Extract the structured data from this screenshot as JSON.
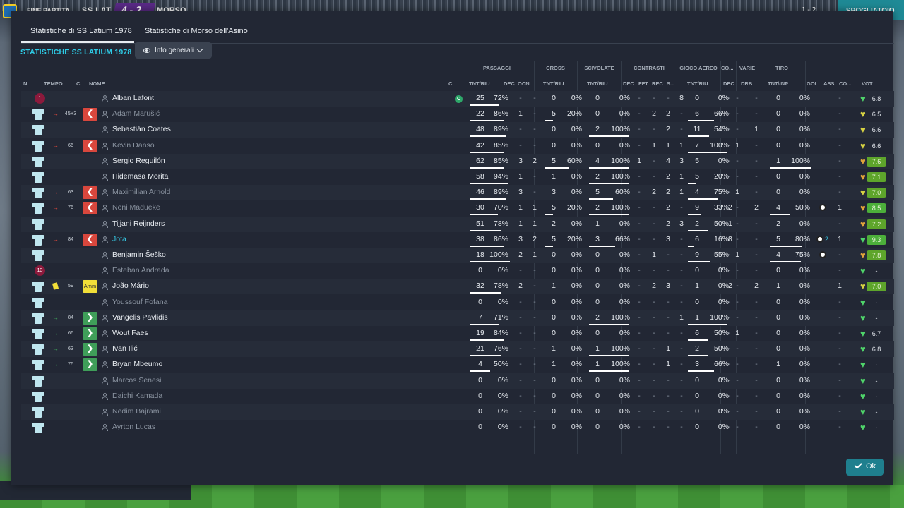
{
  "topbar": {
    "status": "FINE PARTITA",
    "home": "SS LAT",
    "score": "4 - 2",
    "away": "MORSO",
    "time": "1 - 2",
    "continue": "SPOGLIATOIO"
  },
  "tabs": [
    "Statistiche di SS Latium 1978",
    "Statistiche di Morso dell'Asino"
  ],
  "section_title": "STATISTICHE SS LATIUM 1978",
  "view_dropdown": {
    "selected": "Info generali"
  },
  "ok_label": "Ok",
  "colors": {
    "accent": "#2ecbe6",
    "panel": "#222734",
    "sub_out": "#d8473d",
    "sub_in": "#3f9e59",
    "ok": "#1f7f8e"
  },
  "groups": [
    "PASSAGGI",
    "CROSS",
    "SCIVOLATE",
    "CONTRASTI",
    "GIOCO AEREO",
    "VARIE",
    "TIRO"
  ],
  "headers": {
    "n": "N.",
    "tempo": "TEMPO",
    "c": "C",
    "nome": "NOME",
    "c2": "C",
    "pass_tnt": "TNT/RIU",
    "dec": "DEC",
    "ocn": "OCN",
    "cross_tnt": "TNT/RIU",
    "sciv_tnt": "TNT/RIU",
    "con_dec": "DEC",
    "fft": "FFT",
    "rec": "REC",
    "s": "S...",
    "aer_tnt": "TNT/RIU",
    "co": "CO...",
    "aer_dec": "DEC",
    "drb": "DRB",
    "tiro_tnt": "TNT\\INP",
    "gol": "GOL",
    "ass": "ASS",
    "co2": "CO...",
    "vot": "VOT"
  },
  "players": [
    {
      "num": "1",
      "gk": true,
      "name": "Alban Lafont",
      "tempo": "",
      "sub": "",
      "captain": true,
      "dim": false,
      "p": [
        "25",
        "72%",
        "-",
        "-"
      ],
      "cr": [
        "0",
        "0%"
      ],
      "sc": [
        "0",
        "0%"
      ],
      "con": [
        "-",
        "-",
        "-",
        "8"
      ],
      "aer": [
        "0",
        "0%",
        "-",
        "-"
      ],
      "var": "-",
      "ti": [
        "0",
        "0%"
      ],
      "gol": "",
      "ass": "-",
      "heart": "green",
      "vot": "6.8",
      "vcls": "",
      "pbar": 72,
      "crbar": 0,
      "scbar": 0,
      "aerbar": 0,
      "tibar": 0
    },
    {
      "num": "",
      "name": "Adam Marušić",
      "tempo": "45+3",
      "sub": "out",
      "dim": true,
      "p": [
        "22",
        "86%",
        "1",
        "-"
      ],
      "cr": [
        "5",
        "20%"
      ],
      "sc": [
        "0",
        "0%"
      ],
      "con": [
        "-",
        "2",
        "2",
        "-"
      ],
      "aer": [
        "6",
        "66%",
        "-",
        "-"
      ],
      "var": "-",
      "ti": [
        "0",
        "0%"
      ],
      "gol": "",
      "ass": "-",
      "heart": "yellow",
      "vot": "6.5",
      "vcls": "",
      "pbar": 86,
      "crbar": 20,
      "scbar": 0,
      "aerbar": 66,
      "tibar": 0
    },
    {
      "num": "",
      "name": "Sebastián Coates",
      "tempo": "",
      "sub": "",
      "dim": false,
      "p": [
        "48",
        "89%",
        "-",
        "-"
      ],
      "cr": [
        "0",
        "0%"
      ],
      "sc": [
        "2",
        "100%"
      ],
      "con": [
        "-",
        "-",
        "2",
        "-"
      ],
      "aer": [
        "11",
        "54%",
        "-",
        "1"
      ],
      "var": "-",
      "ti": [
        "0",
        "0%"
      ],
      "gol": "",
      "ass": "-",
      "heart": "yellow",
      "vot": "6.6",
      "vcls": "",
      "pbar": 89,
      "crbar": 0,
      "scbar": 100,
      "aerbar": 54,
      "tibar": 0
    },
    {
      "num": "",
      "name": "Kevin Danso",
      "tempo": "66",
      "sub": "out",
      "dim": true,
      "p": [
        "42",
        "85%",
        "-",
        "-"
      ],
      "cr": [
        "0",
        "0%"
      ],
      "sc": [
        "0",
        "0%"
      ],
      "con": [
        "-",
        "1",
        "1",
        "1"
      ],
      "aer": [
        "7",
        "100%",
        "1",
        "-"
      ],
      "var": "-",
      "ti": [
        "0",
        "0%"
      ],
      "gol": "",
      "ass": "-",
      "heart": "yellow",
      "vot": "6.6",
      "vcls": "",
      "pbar": 85,
      "crbar": 0,
      "scbar": 0,
      "aerbar": 100,
      "tibar": 0
    },
    {
      "num": "",
      "name": "Sergio Reguilón",
      "tempo": "",
      "sub": "",
      "dim": false,
      "p": [
        "62",
        "85%",
        "3",
        "2"
      ],
      "cr": [
        "5",
        "60%"
      ],
      "sc": [
        "4",
        "100%"
      ],
      "con": [
        "1",
        "-",
        "4",
        "3"
      ],
      "aer": [
        "5",
        "0%",
        "-",
        "-"
      ],
      "var": "-",
      "ti": [
        "1",
        "100%"
      ],
      "gol": "",
      "ass": "-",
      "heart": "orange",
      "vot": "7.6",
      "vcls": "g1",
      "pbar": 85,
      "crbar": 60,
      "scbar": 100,
      "aerbar": 0,
      "tibar": 100
    },
    {
      "num": "",
      "name": "Hidemasa Morita",
      "tempo": "",
      "sub": "",
      "dim": false,
      "p": [
        "58",
        "94%",
        "1",
        "-"
      ],
      "cr": [
        "1",
        "0%"
      ],
      "sc": [
        "2",
        "100%"
      ],
      "con": [
        "-",
        "-",
        "2",
        "1"
      ],
      "aer": [
        "5",
        "20%",
        "-",
        "-"
      ],
      "var": "-",
      "ti": [
        "0",
        "0%"
      ],
      "gol": "",
      "ass": "-",
      "heart": "orange",
      "vot": "7.1",
      "vcls": "g1",
      "pbar": 94,
      "crbar": 0,
      "scbar": 100,
      "aerbar": 20,
      "tibar": 0
    },
    {
      "num": "",
      "name": "Maximilian Arnold",
      "tempo": "63",
      "sub": "out",
      "dim": true,
      "p": [
        "46",
        "89%",
        "3",
        "-"
      ],
      "cr": [
        "3",
        "0%"
      ],
      "sc": [
        "5",
        "60%"
      ],
      "con": [
        "-",
        "2",
        "2",
        "1"
      ],
      "aer": [
        "4",
        "75%",
        "1",
        "-"
      ],
      "var": "-",
      "ti": [
        "0",
        "0%"
      ],
      "gol": "",
      "ass": "-",
      "heart": "yellow",
      "vot": "7.0",
      "vcls": "g1",
      "pbar": 89,
      "crbar": 0,
      "scbar": 60,
      "aerbar": 75,
      "tibar": 0
    },
    {
      "num": "",
      "name": "Noni Madueke",
      "tempo": "76",
      "sub": "out",
      "dim": true,
      "p": [
        "30",
        "70%",
        "1",
        "1"
      ],
      "cr": [
        "5",
        "20%"
      ],
      "sc": [
        "2",
        "100%"
      ],
      "con": [
        "-",
        "-",
        "2",
        "-"
      ],
      "aer": [
        "9",
        "33%",
        "-",
        "2"
      ],
      "var": "2",
      "ti": [
        "4",
        "50%"
      ],
      "gol": "ball",
      "ass": "1",
      "heart": "orange",
      "vot": "8.5",
      "vcls": "g2",
      "pbar": 70,
      "crbar": 20,
      "scbar": 100,
      "aerbar": 33,
      "tibar": 50
    },
    {
      "num": "",
      "name": "Tijjani Reijnders",
      "tempo": "",
      "sub": "",
      "dim": false,
      "p": [
        "51",
        "78%",
        "1",
        "1"
      ],
      "cr": [
        "2",
        "0%"
      ],
      "sc": [
        "1",
        "0%"
      ],
      "con": [
        "-",
        "-",
        "2",
        "3"
      ],
      "aer": [
        "2",
        "50%",
        "-",
        "-"
      ],
      "var": "1",
      "ti": [
        "2",
        "0%"
      ],
      "gol": "",
      "ass": "-",
      "heart": "orange",
      "vot": "7.2",
      "vcls": "g1",
      "pbar": 78,
      "crbar": 0,
      "scbar": 0,
      "aerbar": 50,
      "tibar": 0
    },
    {
      "num": "",
      "name": "Jota",
      "tempo": "84",
      "sub": "out",
      "dim": false,
      "highlight": true,
      "p": [
        "38",
        "86%",
        "3",
        "2"
      ],
      "cr": [
        "5",
        "20%"
      ],
      "sc": [
        "3",
        "66%"
      ],
      "con": [
        "-",
        "-",
        "3",
        "-"
      ],
      "aer": [
        "6",
        "16%",
        "-",
        "-"
      ],
      "var": "8",
      "ti": [
        "5",
        "80%"
      ],
      "gol": "ball2",
      "ass": "1",
      "heart": "green",
      "vot": "9.3",
      "vcls": "g2",
      "pbar": 86,
      "crbar": 20,
      "scbar": 66,
      "aerbar": 16,
      "tibar": 80
    },
    {
      "num": "",
      "name": "Benjamin Šeško",
      "tempo": "",
      "sub": "",
      "dim": false,
      "p": [
        "18",
        "100%",
        "2",
        "1"
      ],
      "cr": [
        "0",
        "0%"
      ],
      "sc": [
        "0",
        "0%"
      ],
      "con": [
        "-",
        "1",
        "-",
        "-"
      ],
      "aer": [
        "9",
        "55%",
        "1",
        "-"
      ],
      "var": "-",
      "ti": [
        "4",
        "75%"
      ],
      "gol": "ball",
      "ass": "-",
      "heart": "orange",
      "vot": "7.8",
      "vcls": "g1",
      "pbar": 100,
      "crbar": 0,
      "scbar": 0,
      "aerbar": 55,
      "tibar": 75
    },
    {
      "num": "13",
      "gk": true,
      "name": "Esteban Andrada",
      "tempo": "",
      "sub": "",
      "dim": true,
      "p": [
        "0",
        "0%",
        "-",
        "-"
      ],
      "cr": [
        "0",
        "0%"
      ],
      "sc": [
        "0",
        "0%"
      ],
      "con": [
        "-",
        "-",
        "-",
        "-"
      ],
      "aer": [
        "0",
        "0%",
        "-",
        "-"
      ],
      "var": "-",
      "ti": [
        "0",
        "0%"
      ],
      "gol": "",
      "ass": "-",
      "heart": "green",
      "vot": "-",
      "vcls": "",
      "pbar": 0,
      "crbar": 0,
      "scbar": 0,
      "aerbar": 0,
      "tibar": 0
    },
    {
      "num": "",
      "name": "João Mário",
      "tempo": "59",
      "sub": "warn",
      "card": true,
      "dim": false,
      "p": [
        "32",
        "78%",
        "2",
        "-"
      ],
      "cr": [
        "1",
        "0%"
      ],
      "sc": [
        "0",
        "0%"
      ],
      "con": [
        "-",
        "2",
        "3",
        "-"
      ],
      "aer": [
        "1",
        "0%",
        "-",
        "2"
      ],
      "var": "2",
      "ti": [
        "1",
        "0%"
      ],
      "gol": "",
      "ass": "1",
      "heart": "yellow",
      "vot": "7.0",
      "vcls": "g1",
      "pbar": 78,
      "crbar": 0,
      "scbar": 0,
      "aerbar": 0,
      "tibar": 0
    },
    {
      "num": "",
      "name": "Youssouf Fofana",
      "tempo": "",
      "sub": "",
      "dim": true,
      "p": [
        "0",
        "0%",
        "-",
        "-"
      ],
      "cr": [
        "0",
        "0%"
      ],
      "sc": [
        "0",
        "0%"
      ],
      "con": [
        "-",
        "-",
        "-",
        "-"
      ],
      "aer": [
        "0",
        "0%",
        "-",
        "-"
      ],
      "var": "-",
      "ti": [
        "0",
        "0%"
      ],
      "gol": "",
      "ass": "-",
      "heart": "green",
      "vot": "-",
      "vcls": "",
      "pbar": 0,
      "crbar": 0,
      "scbar": 0,
      "aerbar": 0,
      "tibar": 0
    },
    {
      "num": "",
      "name": "Vangelis Pavlidis",
      "tempo": "84",
      "sub": "in",
      "dim": false,
      "p": [
        "7",
        "71%",
        "-",
        "-"
      ],
      "cr": [
        "0",
        "0%"
      ],
      "sc": [
        "2",
        "100%"
      ],
      "con": [
        "-",
        "-",
        "-",
        "1"
      ],
      "aer": [
        "1",
        "100%",
        "-",
        "-"
      ],
      "var": "-",
      "ti": [
        "0",
        "0%"
      ],
      "gol": "",
      "ass": "-",
      "heart": "green",
      "vot": "-",
      "vcls": "",
      "pbar": 71,
      "crbar": 0,
      "scbar": 100,
      "aerbar": 100,
      "tibar": 0
    },
    {
      "num": "",
      "name": "Wout Faes",
      "tempo": "66",
      "sub": "in",
      "dim": false,
      "p": [
        "19",
        "84%",
        "-",
        "-"
      ],
      "cr": [
        "0",
        "0%"
      ],
      "sc": [
        "0",
        "0%"
      ],
      "con": [
        "-",
        "-",
        "-",
        "-"
      ],
      "aer": [
        "6",
        "50%",
        "1",
        "-"
      ],
      "var": "-",
      "ti": [
        "0",
        "0%"
      ],
      "gol": "",
      "ass": "-",
      "heart": "green",
      "vot": "6.7",
      "vcls": "",
      "pbar": 84,
      "crbar": 0,
      "scbar": 0,
      "aerbar": 50,
      "tibar": 0
    },
    {
      "num": "",
      "name": "Ivan Ilić",
      "tempo": "63",
      "sub": "in",
      "dim": false,
      "p": [
        "21",
        "76%",
        "-",
        "-"
      ],
      "cr": [
        "1",
        "0%"
      ],
      "sc": [
        "1",
        "100%"
      ],
      "con": [
        "-",
        "-",
        "1",
        "-"
      ],
      "aer": [
        "2",
        "50%",
        "-",
        "-"
      ],
      "var": "-",
      "ti": [
        "0",
        "0%"
      ],
      "gol": "",
      "ass": "-",
      "heart": "green",
      "vot": "6.8",
      "vcls": "",
      "pbar": 76,
      "crbar": 0,
      "scbar": 100,
      "aerbar": 50,
      "tibar": 0
    },
    {
      "num": "",
      "name": "Bryan Mbeumo",
      "tempo": "76",
      "sub": "in",
      "dim": false,
      "p": [
        "4",
        "50%",
        "-",
        "-"
      ],
      "cr": [
        "1",
        "0%"
      ],
      "sc": [
        "1",
        "100%"
      ],
      "con": [
        "-",
        "-",
        "1",
        "-"
      ],
      "aer": [
        "3",
        "66%",
        "-",
        "-"
      ],
      "var": "-",
      "ti": [
        "1",
        "0%"
      ],
      "gol": "",
      "ass": "-",
      "heart": "green",
      "vot": "-",
      "vcls": "",
      "pbar": 50,
      "crbar": 0,
      "scbar": 100,
      "aerbar": 66,
      "tibar": 0
    },
    {
      "num": "",
      "name": "Marcos Senesi",
      "tempo": "",
      "sub": "",
      "dim": true,
      "p": [
        "0",
        "0%",
        "-",
        "-"
      ],
      "cr": [
        "0",
        "0%"
      ],
      "sc": [
        "0",
        "0%"
      ],
      "con": [
        "-",
        "-",
        "-",
        "-"
      ],
      "aer": [
        "0",
        "0%",
        "-",
        "-"
      ],
      "var": "-",
      "ti": [
        "0",
        "0%"
      ],
      "gol": "",
      "ass": "-",
      "heart": "green",
      "vot": "-",
      "vcls": "",
      "pbar": 0,
      "crbar": 0,
      "scbar": 0,
      "aerbar": 0,
      "tibar": 0
    },
    {
      "num": "",
      "name": "Daichi Kamada",
      "tempo": "",
      "sub": "",
      "dim": true,
      "p": [
        "0",
        "0%",
        "-",
        "-"
      ],
      "cr": [
        "0",
        "0%"
      ],
      "sc": [
        "0",
        "0%"
      ],
      "con": [
        "-",
        "-",
        "-",
        "-"
      ],
      "aer": [
        "0",
        "0%",
        "-",
        "-"
      ],
      "var": "-",
      "ti": [
        "0",
        "0%"
      ],
      "gol": "",
      "ass": "-",
      "heart": "green",
      "vot": "-",
      "vcls": "",
      "pbar": 0,
      "crbar": 0,
      "scbar": 0,
      "aerbar": 0,
      "tibar": 0
    },
    {
      "num": "",
      "name": "Nedim Bajrami",
      "tempo": "",
      "sub": "",
      "dim": true,
      "p": [
        "0",
        "0%",
        "-",
        "-"
      ],
      "cr": [
        "0",
        "0%"
      ],
      "sc": [
        "0",
        "0%"
      ],
      "con": [
        "-",
        "-",
        "-",
        "-"
      ],
      "aer": [
        "0",
        "0%",
        "-",
        "-"
      ],
      "var": "-",
      "ti": [
        "0",
        "0%"
      ],
      "gol": "",
      "ass": "-",
      "heart": "green",
      "vot": "-",
      "vcls": "",
      "pbar": 0,
      "crbar": 0,
      "scbar": 0,
      "aerbar": 0,
      "tibar": 0
    },
    {
      "num": "",
      "name": "Ayrton Lucas",
      "tempo": "",
      "sub": "",
      "dim": true,
      "p": [
        "0",
        "0%",
        "-",
        "-"
      ],
      "cr": [
        "0",
        "0%"
      ],
      "sc": [
        "0",
        "0%"
      ],
      "con": [
        "-",
        "-",
        "-",
        "-"
      ],
      "aer": [
        "0",
        "0%",
        "-",
        "-"
      ],
      "var": "-",
      "ti": [
        "0",
        "0%"
      ],
      "gol": "",
      "ass": "-",
      "heart": "green",
      "vot": "-",
      "vcls": "",
      "pbar": 0,
      "crbar": 0,
      "scbar": 0,
      "aerbar": 0,
      "tibar": 0
    }
  ]
}
